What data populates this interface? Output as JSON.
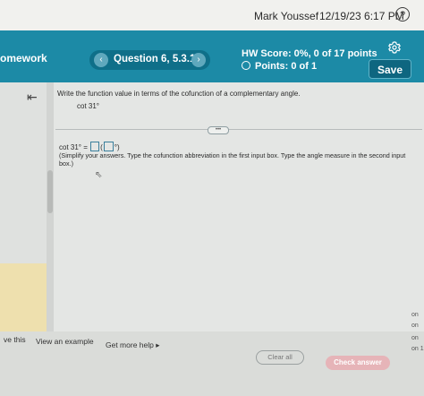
{
  "topbar": {
    "user_name": "Mark Youssef",
    "timestamp": "12/19/23 6:17 PM",
    "help_glyph": "?"
  },
  "header": {
    "section_title": "omework",
    "question_label": "Question 6, 5.3.19",
    "prev_glyph": "‹",
    "next_glyph": "›",
    "hw_score": "HW Score: 0%, 0 of 17 points",
    "points": "Points: 0 of 1",
    "save_label": "Save",
    "accent_color": "#1c8aa6"
  },
  "question": {
    "collapse_glyph": "⇤",
    "instruction": "Write the function value in terms of the cofunction of a complementary angle.",
    "expression": "cot 31°",
    "answer_prefix": "cot 31° =",
    "answer_suffix": "°)",
    "hint": "(Simplify your answers. Type the cofunction abbreviation in the first input box. Type the angle measure in the second input box.)",
    "divider_glyph": "•••"
  },
  "footer": {
    "left_fragment": "ve this",
    "view_example": "View an example",
    "get_more_help": "Get more help ▸",
    "clear_all": "Clear all",
    "check_answer": "Check answer",
    "edge_fragments": [
      "on",
      "on",
      "on",
      "on 1"
    ]
  }
}
